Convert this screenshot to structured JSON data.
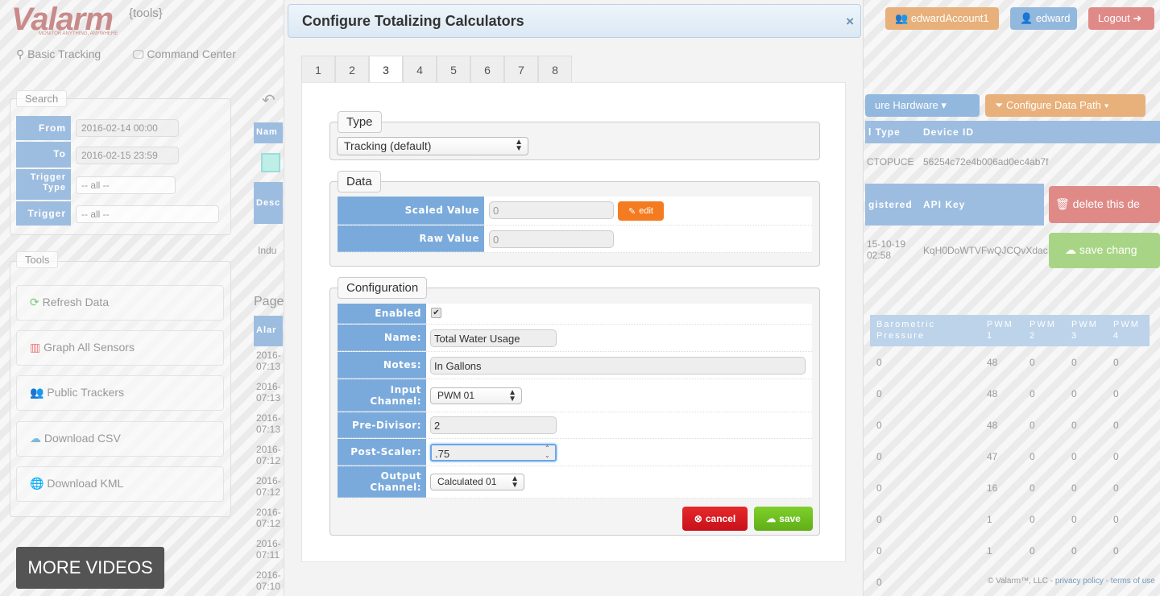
{
  "background": {
    "logo": "Valarm",
    "tagline": "MONITOR ANYTHING, ANYWHERE",
    "tools_tag": "{tools}",
    "nav": [
      "Basic Tracking",
      "Command Center"
    ],
    "header_buttons": {
      "account": "edwardAccount1",
      "user": "edward",
      "logout": "Logout"
    },
    "search": {
      "legend": "Search",
      "from_label": "From",
      "from_value": "2016-02-14 00:00",
      "to_label": "To",
      "to_value": "2016-02-15 23:59",
      "trigger_type_label": "Trigger Type",
      "trigger_type_value": "-- all --",
      "trigger_label": "Trigger",
      "trigger_value": "-- all --"
    },
    "tools": {
      "legend": "Tools",
      "items": [
        "Refresh Data",
        "Graph All Sensors",
        "Public Trackers",
        "Download CSV",
        "Download KML"
      ]
    },
    "middle": {
      "name_header": "Nam",
      "desc_header": "Desc",
      "industry": "Indu",
      "page": "Page",
      "alarm_header": "Alar",
      "timestamps": [
        [
          "2016-",
          "07:13"
        ],
        [
          "2016-",
          "07:13"
        ],
        [
          "2016-",
          "07:13"
        ],
        [
          "2016-",
          "07:12"
        ],
        [
          "2016-",
          "07:12"
        ],
        [
          "2016-",
          "07:12"
        ],
        [
          "2016-",
          "07:11"
        ],
        [
          "2016-",
          "07:10"
        ]
      ]
    },
    "device": {
      "configure_hardware": "ure Hardware",
      "configure_data_path": "Configure Data Path",
      "type_header": "l Type",
      "device_id_header": "Device ID",
      "type_value": "CTOPUCE",
      "device_id_value": "56254c72e4b006ad0ec4ab7f",
      "registered_header": "gistered",
      "api_key_header": "API Key",
      "registered_value": "15-10-19 02:58",
      "api_key_value": "KqH0DoWTVFwQJCQvXdac",
      "delete_button": "delete this de",
      "save_button": "save chang"
    },
    "sensor_table": {
      "headers": [
        "Barometric Pressure",
        "PWM 1",
        "PWM 2",
        "PWM 3",
        "PWM 4"
      ],
      "rows": [
        [
          "0",
          "48",
          "0",
          "0",
          "0"
        ],
        [
          "0",
          "48",
          "0",
          "0",
          "0"
        ],
        [
          "0",
          "48",
          "0",
          "0",
          "0"
        ],
        [
          "0",
          "47",
          "0",
          "0",
          "0"
        ],
        [
          "0",
          "16",
          "0",
          "0",
          "0"
        ],
        [
          "0",
          "1",
          "0",
          "0",
          "0"
        ],
        [
          "0",
          "1",
          "0",
          "0",
          "0"
        ],
        [
          "0"
        ]
      ]
    },
    "footer": {
      "copyright": "© Valarm™, LLC -",
      "privacy": "privacy policy",
      "terms": "terms of use"
    }
  },
  "modal": {
    "title": "Configure Totalizing Calculators",
    "close": "×",
    "tabs": [
      "1",
      "2",
      "3",
      "4",
      "5",
      "6",
      "7",
      "8"
    ],
    "active_tab": "3",
    "type": {
      "legend": "Type",
      "selected": "Tracking (default)"
    },
    "data": {
      "legend": "Data",
      "scaled_label": "Scaled Value",
      "scaled_placeholder": "0",
      "raw_label": "Raw Value",
      "raw_placeholder": "0",
      "edit_button": "edit"
    },
    "configuration": {
      "legend": "Configuration",
      "enabled_label": "Enabled",
      "enabled": true,
      "name_label": "Name:",
      "name_value": "Total Water Usage",
      "notes_label": "Notes:",
      "notes_value": "In Gallons",
      "input_channel_label": "Input Channel:",
      "input_channel_value": "PWM 01",
      "pre_divisor_label": "Pre-Divisor:",
      "pre_divisor_value": "2",
      "post_scaler_label": "Post-Scaler:",
      "post_scaler_value": ".75",
      "output_channel_label": "Output Channel:",
      "output_channel_value": "Calculated 01"
    },
    "cancel_button": "cancel",
    "save_button": "save"
  },
  "overlay_button": "MORE VIDEOS",
  "colors": {
    "label_blue": "#7aaadb",
    "edit_orange": "#f47b20",
    "cancel_red": "#d9151f",
    "save_green": "#6cbf1f"
  }
}
